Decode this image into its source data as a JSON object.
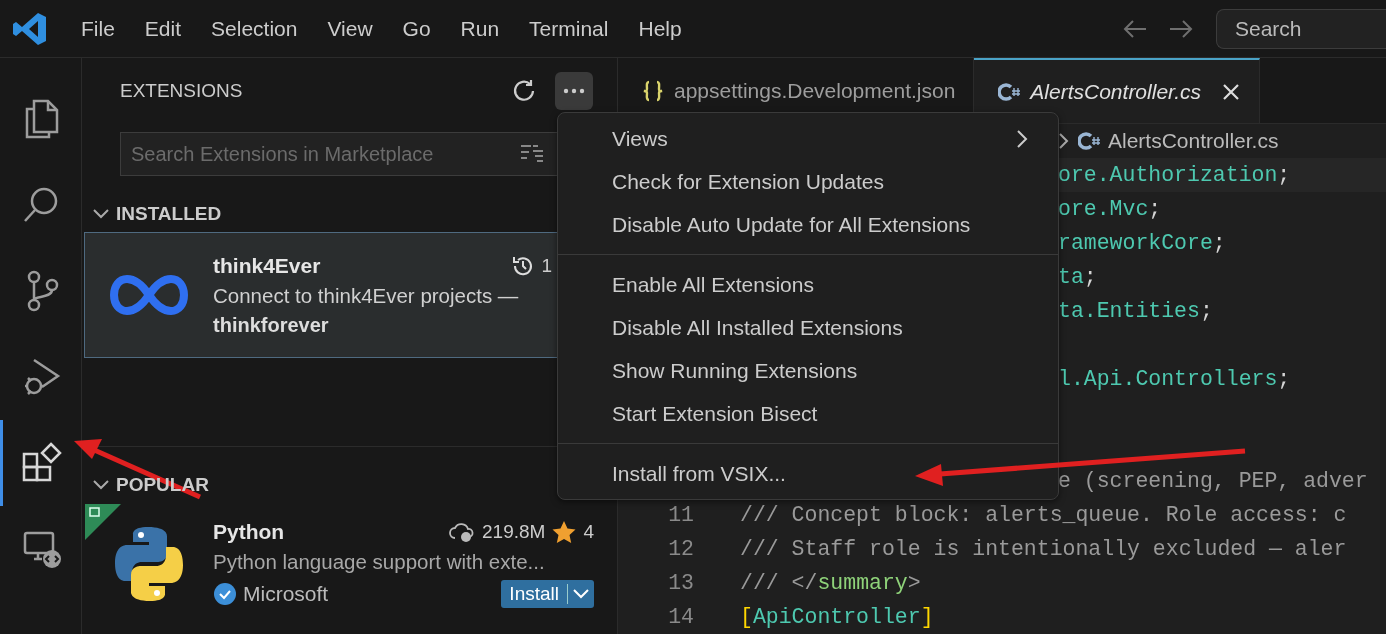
{
  "title_bar": {
    "menus": [
      "File",
      "Edit",
      "Selection",
      "View",
      "Go",
      "Run",
      "Terminal",
      "Help"
    ],
    "search": {
      "placeholder": "Search"
    }
  },
  "activity_bar": [
    {
      "selected": false
    },
    {
      "selected": false
    },
    {
      "selected": false
    },
    {
      "selected": false
    },
    {
      "selected": true
    },
    {
      "selected": false
    }
  ],
  "sidebar": {
    "title": "EXTENSIONS",
    "menu_open": true,
    "search": {
      "placeholder": "Search Extensions in Marketplace"
    },
    "sections": [
      {
        "title": "INSTALLED",
        "expanded": true,
        "items": [
          {
            "name": "think4Ever",
            "update_count": "1",
            "description": "Connect to think4Ever projects —",
            "publisher": "thinkforever",
            "verified": false,
            "selected": true
          }
        ]
      },
      {
        "title": "POPULAR",
        "expanded": true,
        "items": [
          {
            "name": "Python",
            "downloads": "219.8M",
            "rating": "4",
            "description": "Python language support with exte...",
            "publisher": "Microsoft",
            "verified": true,
            "action": "Install",
            "selected": false
          }
        ]
      }
    ]
  },
  "editor": {
    "tabs": [
      {
        "label": "appsettings.Development.json",
        "selected": false
      },
      {
        "label": "AlertsController.cs",
        "selected": true
      }
    ],
    "breadcrumb": {
      "label": "AlertsController.cs"
    },
    "lines": [
      {
        "tokens": [
          {
            "kind": "type",
            "text": "ore.Authorization"
          },
          {
            "kind": "plain",
            "text": ";"
          }
        ]
      },
      {
        "tokens": [
          {
            "kind": "type",
            "text": "ore.Mvc"
          },
          {
            "kind": "plain",
            "text": ";"
          }
        ]
      },
      {
        "tokens": [
          {
            "kind": "type",
            "text": "rameworkCore"
          },
          {
            "kind": "plain",
            "text": ";"
          }
        ]
      },
      {
        "tokens": [
          {
            "kind": "type",
            "text": "ta"
          },
          {
            "kind": "plain",
            "text": ";"
          }
        ]
      },
      {
        "tokens": [
          {
            "kind": "type",
            "text": "ta.Entities"
          },
          {
            "kind": "plain",
            "text": ";"
          }
        ]
      },
      {
        "kind": "blank"
      },
      {
        "tokens": [
          {
            "kind": "type",
            "text": "l.Api.Controllers"
          },
          {
            "kind": "plain",
            "text": ";"
          }
        ]
      },
      {
        "kind": "blank"
      },
      {
        "kind": "blank"
      },
      {
        "tokens": [
          {
            "kind": "comment",
            "text": "e (screening, PEP, adver"
          }
        ]
      },
      {
        "number": "11",
        "tokens": [
          {
            "kind": "comment",
            "text": "/// Concept block: alerts_queue. Role access: c"
          }
        ]
      },
      {
        "number": "12",
        "tokens": [
          {
            "kind": "comment",
            "text": "/// Staff role is intentionally excluded — aler"
          }
        ]
      },
      {
        "number": "13",
        "tokens": [
          {
            "kind": "comment",
            "text": "/// </"
          },
          {
            "kind": "tag",
            "text": "summary"
          },
          {
            "kind": "comment",
            "text": ">"
          }
        ]
      },
      {
        "number": "14",
        "tokens": [
          {
            "kind": "bracket",
            "text": "["
          },
          {
            "kind": "type",
            "text": "ApiController"
          },
          {
            "kind": "bracket",
            "text": "]"
          }
        ]
      }
    ]
  },
  "context_menu": {
    "groups": [
      [
        {
          "label": "Views",
          "submenu": true
        },
        {
          "label": "Check for Extension Updates",
          "submenu": false
        },
        {
          "label": "Disable Auto Update for All Extensions",
          "submenu": false
        }
      ],
      [
        {
          "label": "Enable All Extensions",
          "submenu": false
        },
        {
          "label": "Disable All Installed Extensions",
          "submenu": false
        },
        {
          "label": "Show Running Extensions",
          "submenu": false
        },
        {
          "label": "Start Extension Bisect",
          "submenu": false
        }
      ],
      [
        {
          "label": "Install from VSIX...",
          "submenu": false
        }
      ]
    ]
  }
}
